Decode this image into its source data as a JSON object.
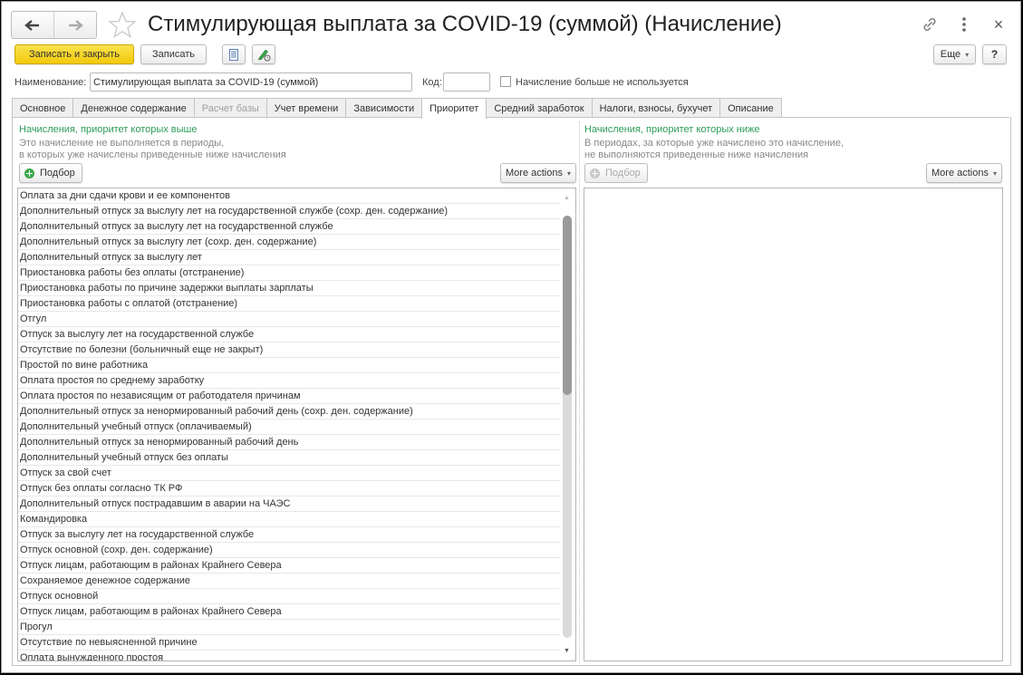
{
  "window": {
    "title": "Стимулирующая выплата за COVID-19 (суммой) (Начисление)",
    "nav_back_icon": "arrow-left-icon",
    "nav_forward_icon": "arrow-right-icon",
    "favorite_icon": "star-icon",
    "link_icon": "link-icon",
    "more_icon": "kebab-menu-icon",
    "close_icon": "close-icon",
    "close_glyph": "×"
  },
  "toolbar": {
    "save_close_label": "Записать и закрыть",
    "save_label": "Записать",
    "list_icon": "document-list-icon",
    "edit_icon": "pencil-edit-icon",
    "eshe_label": "Еще",
    "eshe_caret": "▾",
    "help_label": "?"
  },
  "form": {
    "name_label": "Наименование:",
    "name_value": "Стимулирующая выплата за COVID-19 (суммой)",
    "code_label": "Код:",
    "code_value": "",
    "not_used_label": "Начисление больше не используется",
    "not_used_checked": false
  },
  "tabs": [
    {
      "label": "Основное",
      "state": "normal"
    },
    {
      "label": "Денежное содержание",
      "state": "normal"
    },
    {
      "label": "Расчет базы",
      "state": "disabled"
    },
    {
      "label": "Учет времени",
      "state": "normal"
    },
    {
      "label": "Зависимости",
      "state": "normal"
    },
    {
      "label": "Приоритет",
      "state": "active"
    },
    {
      "label": "Средний заработок",
      "state": "normal"
    },
    {
      "label": "Налоги, взносы, бухучет",
      "state": "normal"
    },
    {
      "label": "Описание",
      "state": "normal"
    }
  ],
  "left_panel": {
    "title": "Начисления, приоритет которых выше",
    "desc_line1": "Это начисление не выполняется в периоды,",
    "desc_line2": "в которых уже начислены приведенные ниже начисления",
    "pick_label": "Подбор",
    "more_actions_label": "More actions",
    "more_caret": "▾",
    "items": [
      "Оплата за дни сдачи крови и ее компонентов",
      "Дополнительный отпуск за выслугу лет на государственной службе (сохр. ден. содержание)",
      "Дополнительный отпуск за выслугу лет на государственной службе",
      "Дополнительный отпуск за выслугу лет (сохр. ден. содержание)",
      "Дополнительный отпуск за выслугу лет",
      "Приостановка работы без оплаты (отстранение)",
      "Приостановка работы по причине задержки выплаты зарплаты",
      "Приостановка работы с оплатой (отстранение)",
      "Отгул",
      "Отпуск за выслугу лет на государственной службе",
      "Отсутствие по болезни (больничный еще не закрыт)",
      "Простой по вине работника",
      "Оплата простоя по среднему заработку",
      "Оплата простоя по независящим от работодателя причинам",
      "Дополнительный отпуск за ненормированный рабочий день (сохр. ден. содержание)",
      "Дополнительный учебный отпуск (оплачиваемый)",
      "Дополнительный отпуск за ненормированный рабочий день",
      "Дополнительный учебный отпуск без оплаты",
      "Отпуск за свой счет",
      "Отпуск без оплаты согласно ТК РФ",
      "Дополнительный отпуск пострадавшим в аварии на ЧАЭС",
      "Командировка",
      "Отпуск за выслугу лет на государственной службе",
      "Отпуск основной (сохр. ден. содержание)",
      "Отпуск лицам, работающим в районах Крайнего Севера",
      "Сохраняемое денежное содержание",
      "Отпуск основной",
      "Отпуск лицам, работающим в районах Крайнего Севера",
      "Прогул",
      "Отсутствие по невыясненной причине",
      "Оплата вынужденного простоя"
    ],
    "scroll_up_glyph": "▲",
    "scroll_down_glyph": "▼"
  },
  "right_panel": {
    "title": "Начисления, приоритет которых ниже",
    "desc_line1": "В периодах, за которые уже начислено это начисление,",
    "desc_line2": "не выполняются приведенные ниже начисления",
    "pick_label": "Подбор",
    "pick_disabled": true,
    "more_actions_label": "More actions",
    "more_caret": "▾",
    "items": []
  }
}
